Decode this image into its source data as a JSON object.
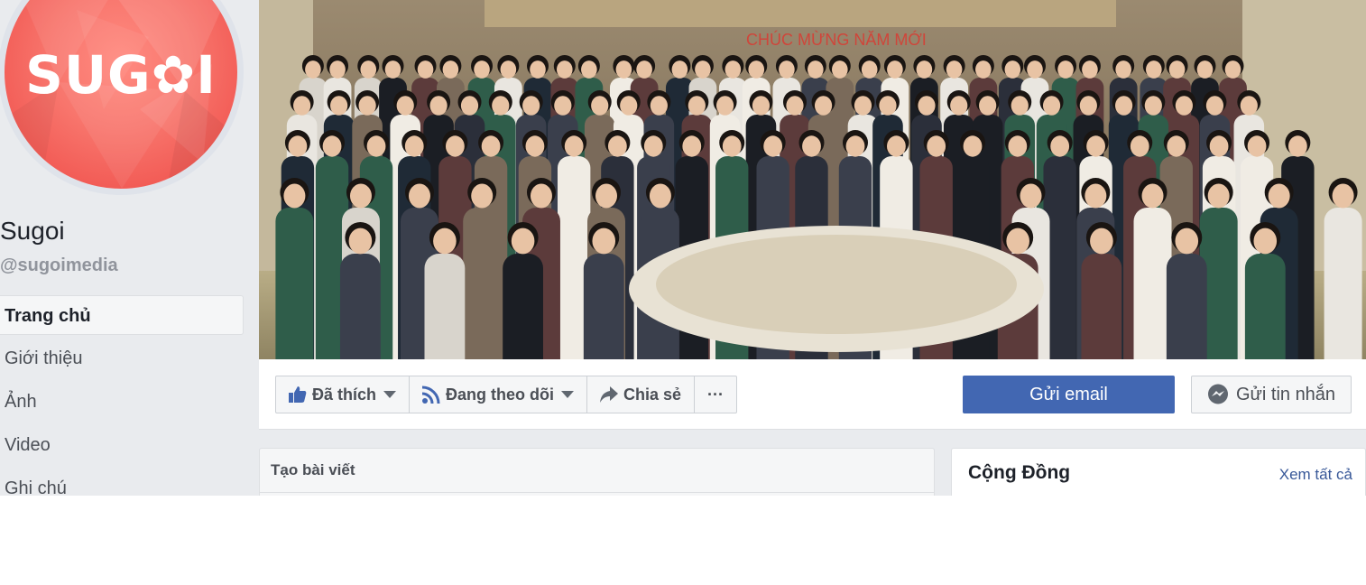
{
  "page": {
    "name": "Sugoi",
    "handle": "@sugoimedia",
    "logo_text": "SUG✿I"
  },
  "nav": {
    "items": [
      {
        "label": "Trang chủ",
        "active": true
      },
      {
        "label": "Giới thiệu"
      },
      {
        "label": "Ảnh"
      },
      {
        "label": "Video"
      },
      {
        "label": "Ghi chú"
      }
    ]
  },
  "cover": {
    "banner_text": "CHÚC MỪNG NĂM MỚI"
  },
  "actions": {
    "liked": "Đã thích",
    "following": "Đang theo dõi",
    "share": "Chia sẻ",
    "more": "···",
    "email": "Gửi email",
    "message": "Gửi tin nhắn"
  },
  "composer": {
    "title": "Tạo bài viết"
  },
  "community": {
    "title": "Cộng Đồng",
    "see_all": "Xem tất cả"
  },
  "colors": {
    "brand": "#4267b2",
    "logo_red": "#f25b55",
    "background": "#e9ebee"
  },
  "icons": [
    "thumbs-up-icon",
    "rss-icon",
    "share-arrow-icon",
    "messenger-icon",
    "caret-down-icon"
  ]
}
